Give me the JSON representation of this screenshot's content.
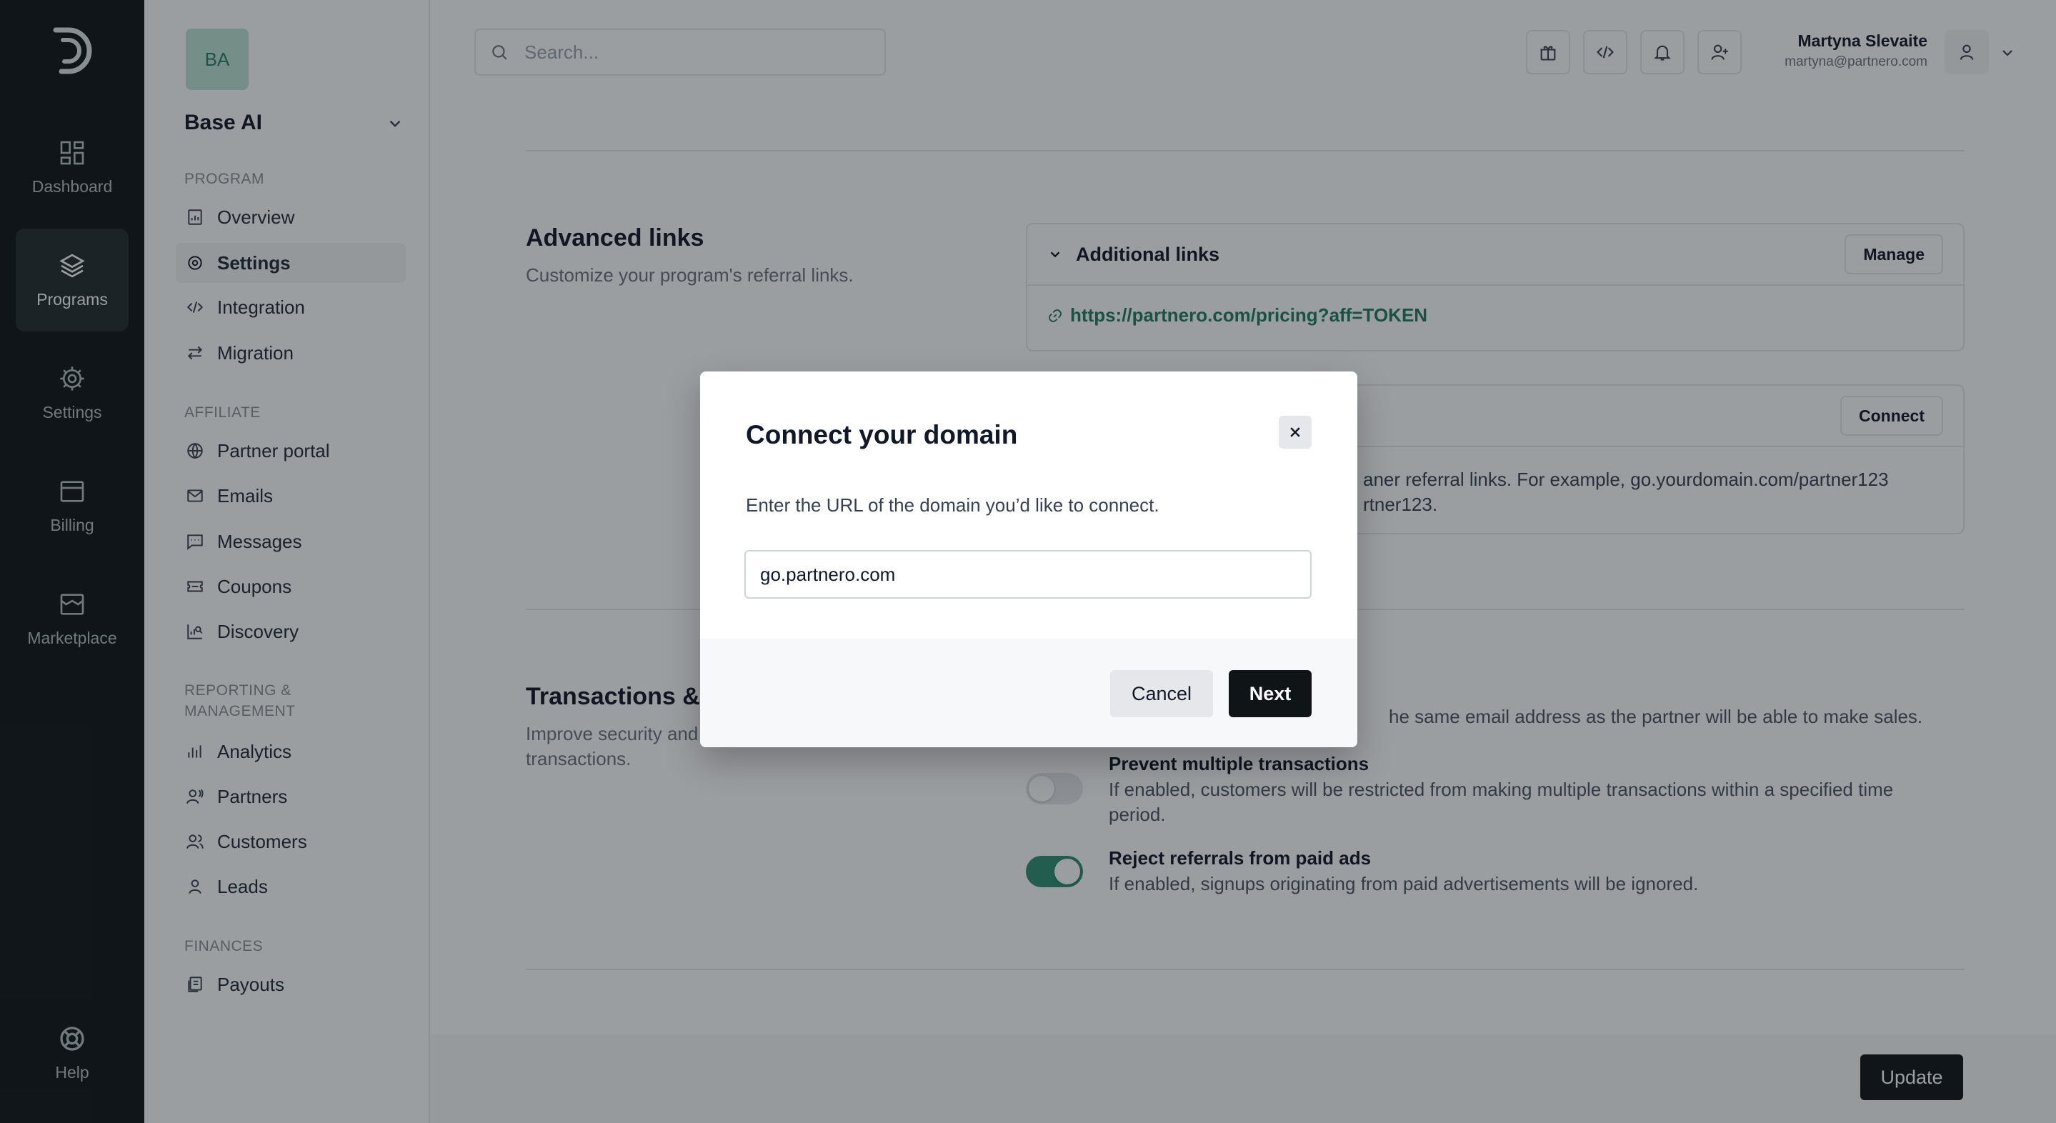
{
  "rail": {
    "items": [
      {
        "label": "Dashboard",
        "icon": "grid-icon"
      },
      {
        "label": "Programs",
        "icon": "layers-icon"
      },
      {
        "label": "Settings",
        "icon": "gear-icon"
      },
      {
        "label": "Billing",
        "icon": "billing-icon"
      },
      {
        "label": "Marketplace",
        "icon": "store-icon"
      }
    ],
    "help": "Help"
  },
  "sidebar": {
    "avatar": "BA",
    "workspace": "Base AI",
    "sections": {
      "program": "PROGRAM",
      "affiliate": "AFFILIATE",
      "reporting": "REPORTING &",
      "reporting2": "MANAGEMENT",
      "finances": "FINANCES"
    },
    "items": [
      "Overview",
      "Settings",
      "Integration",
      "Migration",
      "Partner portal",
      "Emails",
      "Messages",
      "Coupons",
      "Discovery",
      "Analytics",
      "Partners",
      "Customers",
      "Leads",
      "Payouts"
    ]
  },
  "topbar": {
    "search_placeholder": "Search...",
    "user_name": "Martyna Slevaite",
    "user_email": "martyna@partnero.com"
  },
  "content": {
    "advanced": {
      "title": "Advanced links",
      "desc": "Customize your program's referral links.",
      "card1_title": "Additional links",
      "card1_button": "Manage",
      "card1_link": "https://partnero.com/pricing?aff=TOKEN",
      "card2_button": "Connect",
      "card2_text1": "aner referral links. For example, go.yourdomain.com/partner123",
      "card2_text2": "rtner123."
    },
    "transactions": {
      "title": "Transactions & l",
      "desc": "Improve security and transactions.",
      "desc_line1": "Improve security and",
      "desc_line2": "transactions.",
      "opt0_desc": "he same email address as the partner will be able to make sales.",
      "opt1_title": "Prevent multiple transactions",
      "opt1_desc": "If enabled, customers will be restricted from making multiple transactions within a specified time period.",
      "opt2_title": "Reject referrals from paid ads",
      "opt2_desc": "If enabled, signups originating from paid advertisements will be ignored."
    },
    "update_button": "Update"
  },
  "modal": {
    "title": "Connect your domain",
    "desc": "Enter the URL of the domain you’d like to connect.",
    "input_value": "go.partnero.com",
    "cancel": "Cancel",
    "next": "Next"
  },
  "colors": {
    "accent": "#2f8f75",
    "rail_bg": "#0f1416"
  }
}
